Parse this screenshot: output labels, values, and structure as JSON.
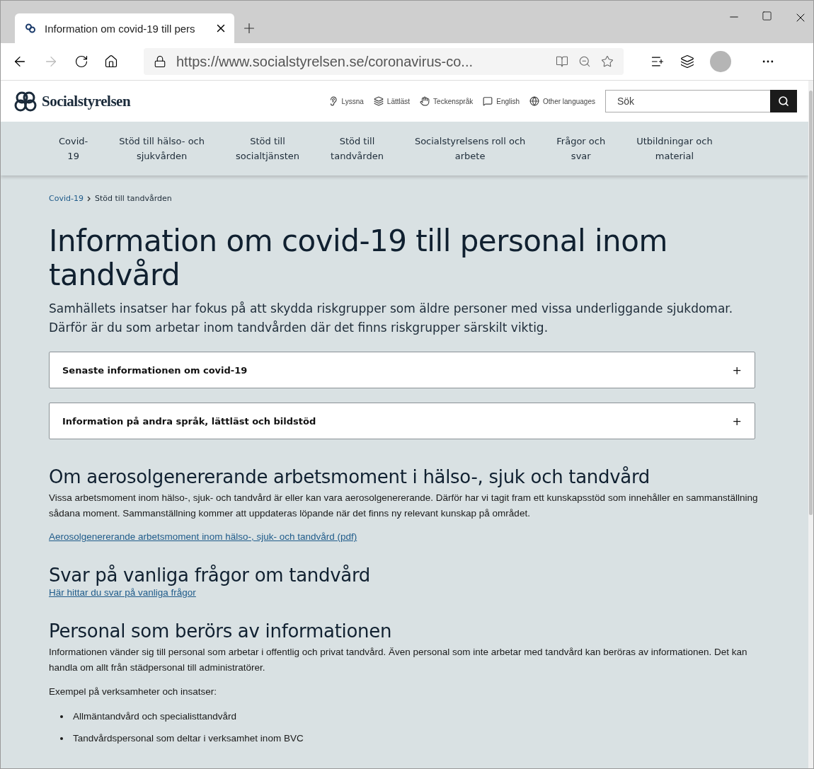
{
  "browser": {
    "tab_title": "Information om covid-19 till pers",
    "url": "https://www.socialstyrelsen.se/coronavirus-co..."
  },
  "site": {
    "logo_text": "Socialstyrelsen",
    "tools": [
      {
        "kind": "listen",
        "label": "Lyssna"
      },
      {
        "kind": "easy",
        "label": "Lättläst"
      },
      {
        "kind": "sign",
        "label": "Teckenspråk"
      },
      {
        "kind": "english",
        "label": "English"
      },
      {
        "kind": "globe",
        "label": "Other languages"
      }
    ],
    "search": {
      "placeholder": "Sök"
    },
    "nav": [
      "Covid-\n19",
      "Stöd till hälso- och\nsjukvården",
      "Stöd till\nsocialtjänsten",
      "Stöd till\ntandvården",
      "Socialstyrelsens roll och\narbete",
      "Frågor och\nsvar",
      "Utbildningar och\nmaterial"
    ]
  },
  "breadcrumb": [
    {
      "label": "Covid-19",
      "kind": "link"
    },
    {
      "label": "Stöd till tandvården",
      "kind": "current"
    }
  ],
  "title": "Information om covid-19 till personal inom tandvård",
  "lead": "Samhällets insatser har fokus på att skydda riskgrupper som äldre personer med vissa underliggande sjukdomar. Därför är du som arbetar inom tandvården där det finns riskgrupper särskilt viktig.",
  "accordions": [
    {
      "title": "Senaste informationen om covid-19",
      "toggle": "+"
    },
    {
      "title": "Information på andra språk, lättläst och bildstöd",
      "toggle": "+"
    }
  ],
  "content": [
    {
      "kind": "heading",
      "text": "Om aerosolgenererande arbetsmoment i hälso-, sjuk och tandvård"
    },
    {
      "kind": "paragraph",
      "text": "Vissa arbetsmoment inom hälso-, sjuk- och tandvård är eller kan vara aerosolgenererande. Därför har vi tagit fram ett kunskapsstöd som innehåller en sammanställning sådana moment. Sammanställning kommer att uppdateras löpande när det finns ny relevant kunskap på området."
    },
    {
      "kind": "link",
      "text": "Aerosolgenererande arbetsmoment inom hälso-, sjuk- och tandvård (pdf)"
    },
    {
      "kind": "heading",
      "text": "Svar på vanliga frågor om tandvård"
    },
    {
      "kind": "link",
      "text": "Här hittar du svar på vanliga frågor"
    },
    {
      "kind": "heading",
      "text": "Personal som berörs av informationen"
    },
    {
      "kind": "paragraph",
      "text": "Informationen vänder sig till personal som arbetar i offentlig och privat tandvård. Även personal som inte arbetar med tandvård kan beröras av informationen. Det kan handla om allt från städpersonal till administratörer."
    },
    {
      "kind": "paragraph",
      "text": "Exempel på verksamheter och insatser:"
    },
    {
      "kind": "bullet",
      "text": "Allmäntandvård och specialisttandvård"
    },
    {
      "kind": "bullet",
      "text": "Tandvårdspersonal som deltar i verksamhet inom BVC"
    }
  ]
}
